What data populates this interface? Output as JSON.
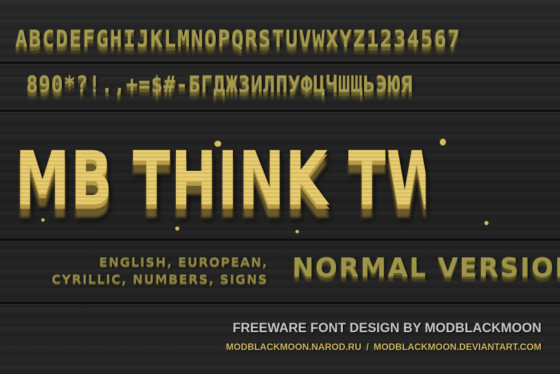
{
  "specimen": {
    "alphabet_row": "ABCDEFGHIJKLMNOPQRSTUVWXYZ1234567",
    "glyph_row": "890*?!.,+=$#-БГДЖЗИЛПУФЦЧШЩЬЭЮЯ"
  },
  "title": "MB THINK TWICE",
  "coverage": {
    "line1": "ENGLISH, EUROPEAN,",
    "line2": "CYRILLIC, NUMBERS, SIGNS"
  },
  "version": "NORMAL VERSION",
  "credit": "FREEWARE FONT DESIGN BY MODBLACKMOON",
  "links": {
    "site1": "MODBLACKMOON.NAROD.RU",
    "separator": "/",
    "site2": "MODBLACKMOON.DEVIANTART.COM"
  },
  "colors": {
    "background": "#1f1f1f",
    "specimen_text": "#a59a50",
    "title_gold": "#e6cc72",
    "credit_text": "#c9c9c9",
    "link_gold": "#cfb860"
  }
}
